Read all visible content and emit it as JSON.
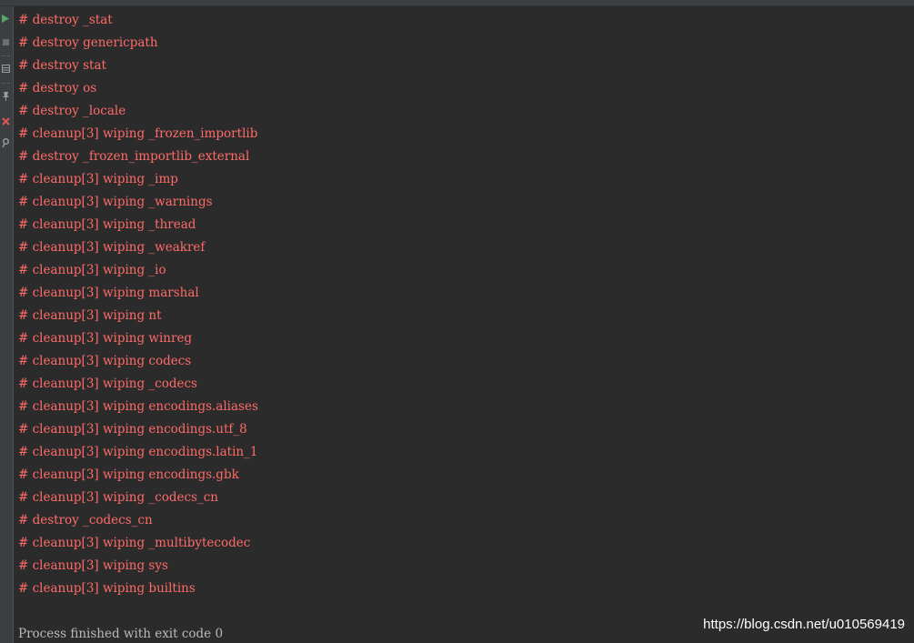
{
  "colors": {
    "stderr_text": "#ff6b68",
    "stdout_text": "#bbbbbb",
    "background": "#2b2b2b",
    "run_icon": "#59a869",
    "close_icon": "#e05555"
  },
  "toolbar": {
    "icons": [
      "run-icon",
      "stop-icon",
      "layout-icon",
      "pin-icon",
      "close-icon",
      "settings-icon"
    ]
  },
  "console": {
    "lines": [
      "# destroy _stat",
      "# destroy genericpath",
      "# destroy stat",
      "# destroy os",
      "# destroy _locale",
      "# cleanup[3] wiping _frozen_importlib",
      "# destroy _frozen_importlib_external",
      "# cleanup[3] wiping _imp",
      "# cleanup[3] wiping _warnings",
      "# cleanup[3] wiping _thread",
      "# cleanup[3] wiping _weakref",
      "# cleanup[3] wiping _io",
      "# cleanup[3] wiping marshal",
      "# cleanup[3] wiping nt",
      "# cleanup[3] wiping winreg",
      "# cleanup[3] wiping codecs",
      "# cleanup[3] wiping _codecs",
      "# cleanup[3] wiping encodings.aliases",
      "# cleanup[3] wiping encodings.utf_8",
      "# cleanup[3] wiping encodings.latin_1",
      "# cleanup[3] wiping encodings.gbk",
      "# cleanup[3] wiping _codecs_cn",
      "# destroy _codecs_cn",
      "# cleanup[3] wiping _multibytecodec",
      "# cleanup[3] wiping sys",
      "# cleanup[3] wiping builtins"
    ],
    "exit_message": "Process finished with exit code 0"
  },
  "watermark": "https://blog.csdn.net/u010569419"
}
